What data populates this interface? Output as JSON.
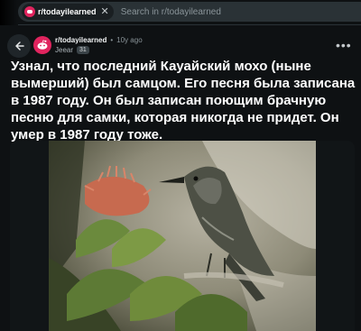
{
  "search": {
    "community_chip": "r/todayilearned",
    "placeholder": "Search in r/todayilearned"
  },
  "post": {
    "subreddit": "r/todayilearned",
    "separator": "•",
    "age": "10y ago",
    "author": "Jeear",
    "flair": "31",
    "menu_label": "•••",
    "title": "Узнал, что последний Кауайский мохо (ныне вымерший) был самцом. Его песня была записана в 1987 году. Он был записан поющим брачную песню для самки, которая никогда не придет. Он умер в 1987 году тоже."
  },
  "icons": {
    "back": "back-arrow-icon",
    "close": "close-icon",
    "community": "reddit-community-icon",
    "more": "more-options-icon"
  },
  "colors": {
    "background": "#0e1113",
    "search_bg": "#2a3236",
    "community_red": "#e0245e",
    "text": "#ffffff",
    "muted": "#8a9499"
  }
}
